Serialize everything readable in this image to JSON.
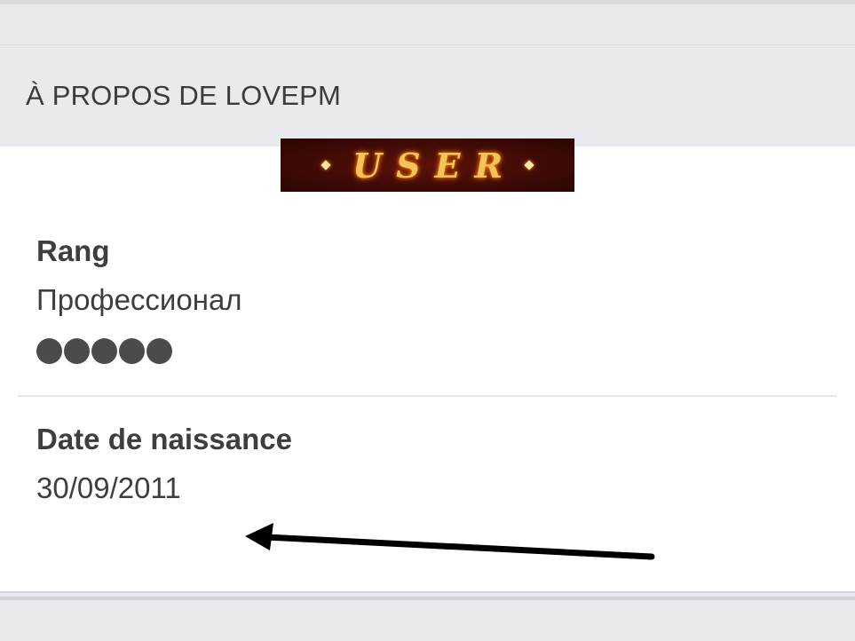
{
  "about": {
    "title": "À PROPOS DE LOVEPM",
    "rank_image_text": "USER",
    "rank_label": "Rang",
    "rank_value": "Профессионал",
    "rank_level": 5,
    "birthdate_label": "Date de naissance",
    "birthdate_value": "30/09/2011"
  },
  "colors": {
    "card_background": "#ffffff",
    "header_background": "#e9eaed",
    "text": "#3d3e40",
    "dot": "#4a4b4d",
    "arrow": "#000000"
  },
  "icons": {
    "annotation": "arrow-left-icon"
  }
}
